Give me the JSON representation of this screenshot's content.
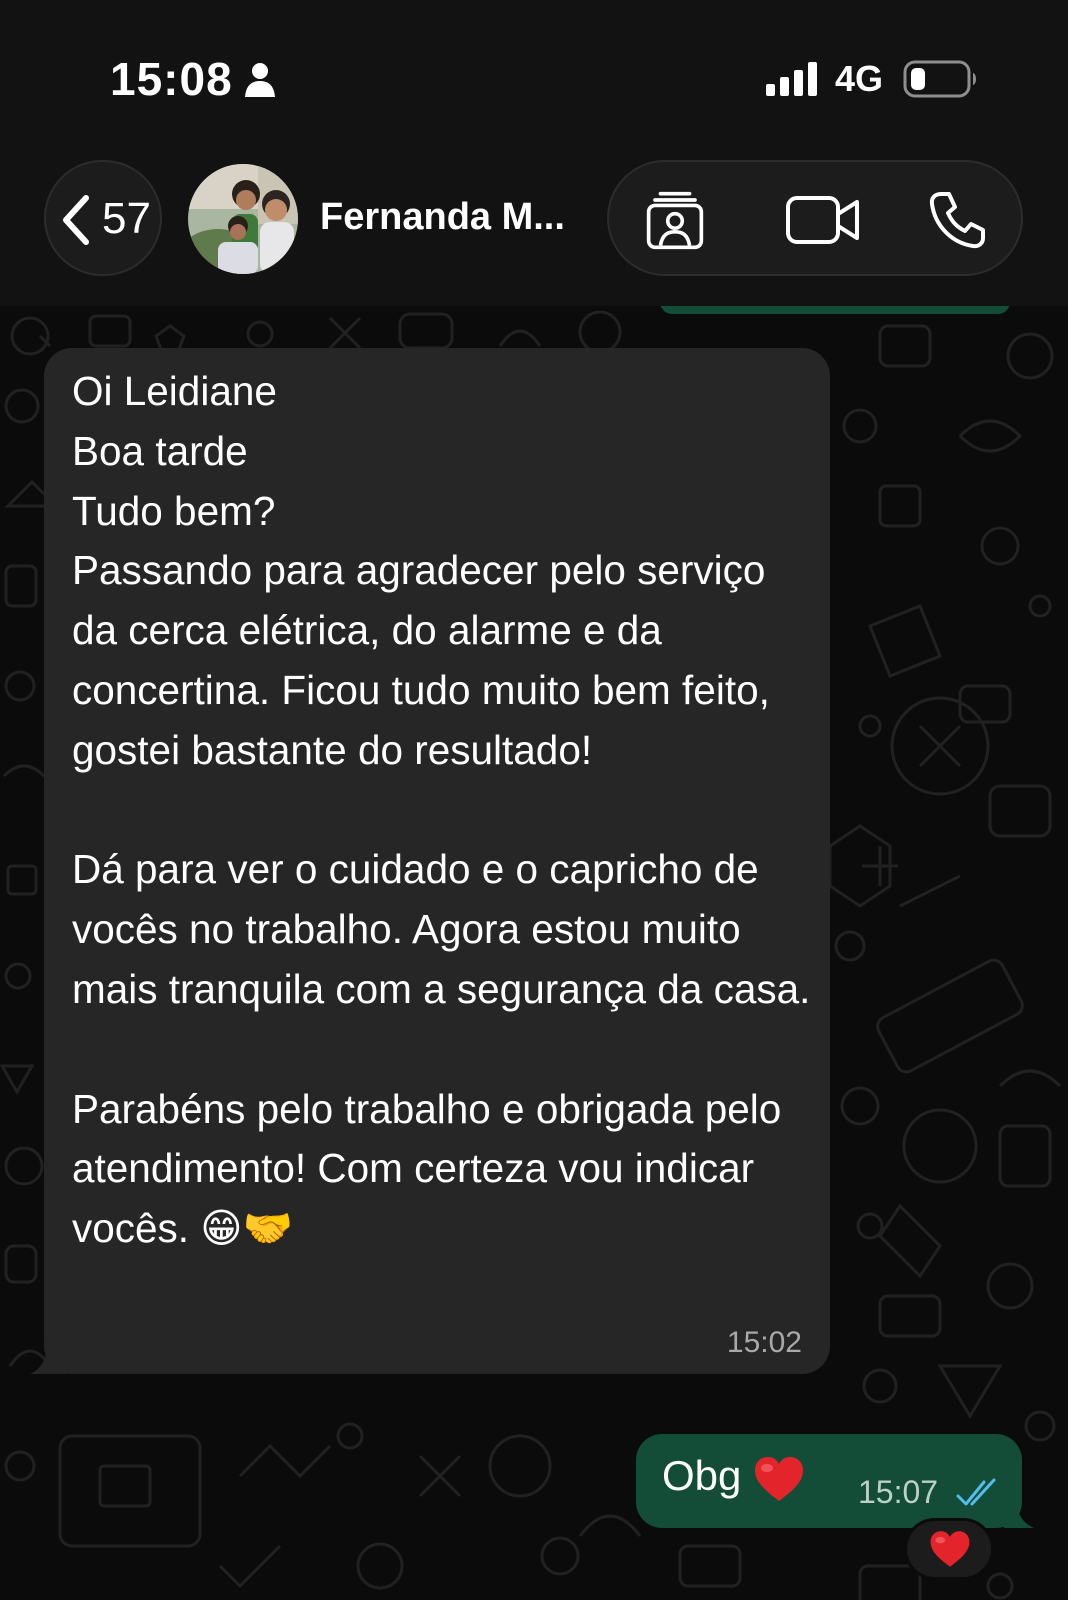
{
  "status_bar": {
    "time": "15:08",
    "network": "4G",
    "icons": [
      "person-icon",
      "signal-icon",
      "battery-icon"
    ]
  },
  "header": {
    "back_count": "57",
    "contact_name": "Fernanda M...",
    "icons": [
      "chevron-left-icon",
      "contact-card-icon",
      "video-call-icon",
      "phone-icon"
    ]
  },
  "messages": {
    "incoming": {
      "text": "Oi Leidiane\nBoa tarde\nTudo bem?\nPassando para agradecer pelo serviço da cerca elétrica, do alarme e da concertina. Ficou tudo muito bem feito, gostei bastante do resultado!\n\nDá para ver o cuidado e o capricho de vocês no trabalho. Agora estou muito mais tranquila com a segurança da casa.\n\nParabéns pelo trabalho e obrigada pelo atendimento! Com certeza vou indicar vocês. 😁🤝",
      "time": "15:02"
    },
    "outgoing": {
      "text": "Obg",
      "emoji": "heart-emoji",
      "time": "15:07",
      "status_icon": "double-check-icon"
    },
    "reaction": "heart-emoji"
  },
  "colors": {
    "background": "#0b0b0b",
    "header": "#121212",
    "incoming_bubble": "#252625",
    "outgoing_bubble": "#134d37",
    "read_tick": "#53bdeb",
    "heart": "#e3242b"
  }
}
